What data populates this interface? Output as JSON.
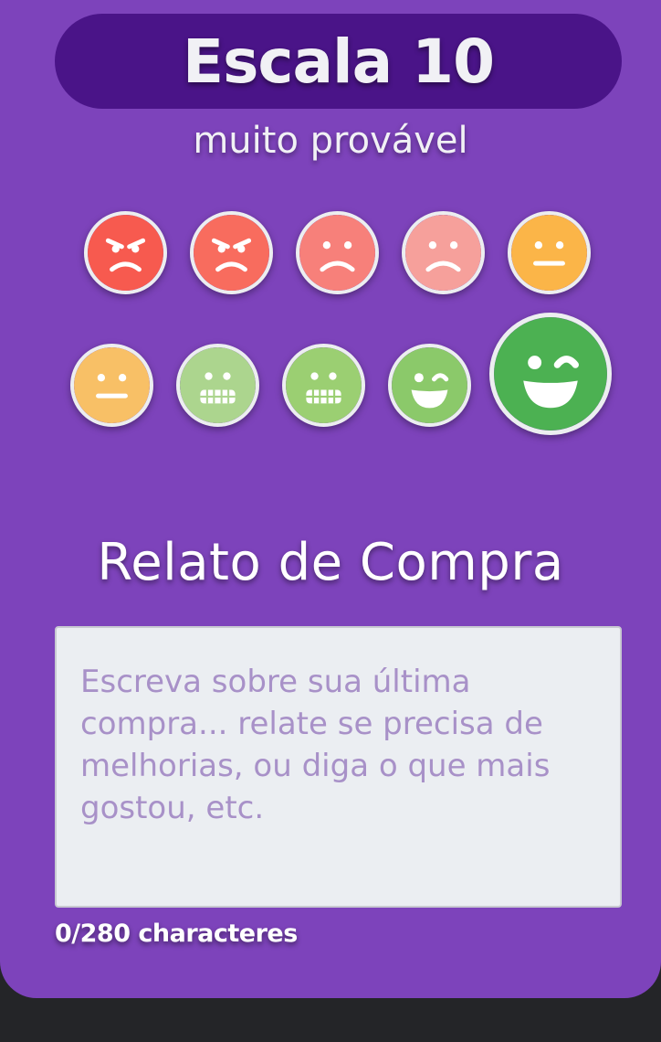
{
  "header": {
    "title": "Escala 10",
    "subtitle": "muito provável"
  },
  "rating": {
    "selected": 10,
    "faces": [
      {
        "value": 1,
        "icon": "angry-face-icon",
        "color": "#f75a4f"
      },
      {
        "value": 2,
        "icon": "angry-face-icon",
        "color": "#f86c5e"
      },
      {
        "value": 3,
        "icon": "sad-face-icon",
        "color": "#f7807a"
      },
      {
        "value": 4,
        "icon": "sad-face-icon",
        "color": "#f6a09b"
      },
      {
        "value": 5,
        "icon": "neutral-face-icon",
        "color": "#fbb548"
      },
      {
        "value": 6,
        "icon": "neutral-face-icon",
        "color": "#f8c066"
      },
      {
        "value": 7,
        "icon": "grimace-face-icon",
        "color": "#acd58e"
      },
      {
        "value": 8,
        "icon": "grimace-face-icon",
        "color": "#9bcf72"
      },
      {
        "value": 9,
        "icon": "wink-face-icon",
        "color": "#8bc96a"
      },
      {
        "value": 10,
        "icon": "wink-face-icon",
        "color": "#4cb152"
      }
    ]
  },
  "report": {
    "title": "Relato de Compra",
    "placeholder": "Escreva sobre sua última compra... relate se precisa de melhorias, ou diga o que mais gostou, etc.",
    "value": "",
    "counter": "0/280 characteres"
  },
  "colors": {
    "card_background": "#7d43bb",
    "title_pill": "#4a1488",
    "page_background": "#242528",
    "input_background": "#ebeef2",
    "placeholder": "#a891c8"
  }
}
